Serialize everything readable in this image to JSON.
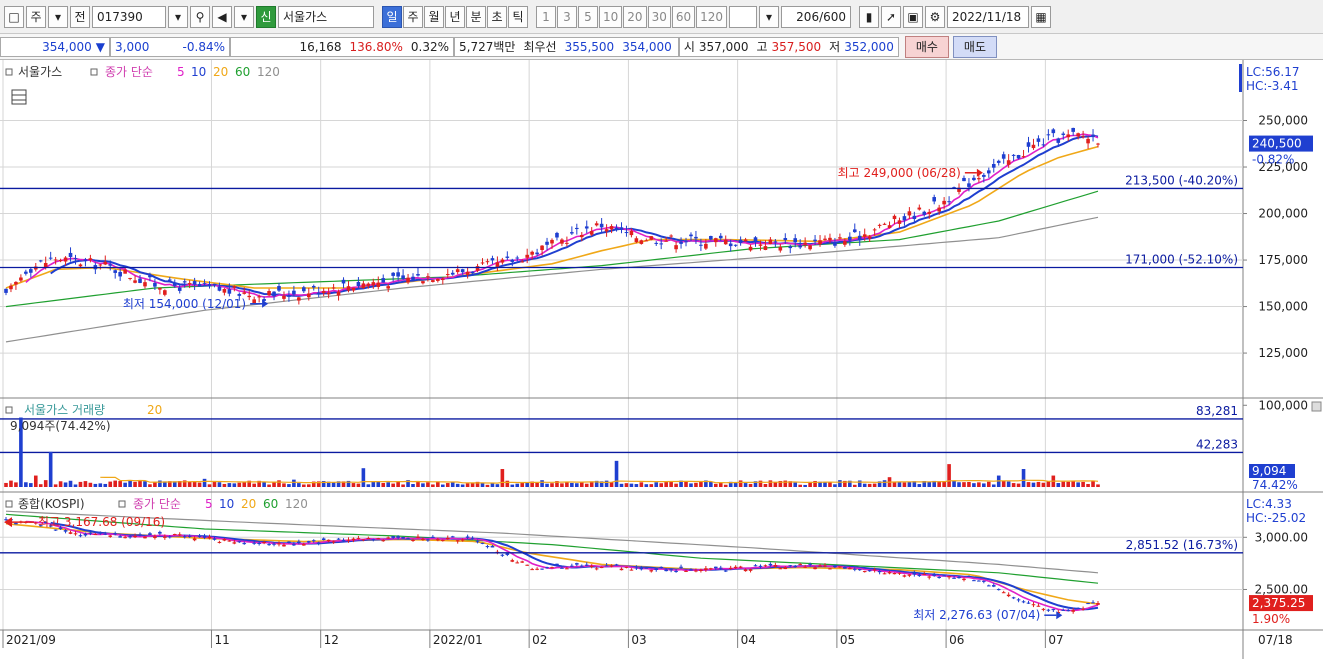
{
  "toolbar": {
    "type_label": "주",
    "prev_label": "전",
    "code": "017390",
    "new_badge": "신",
    "stock_name": "서울가스",
    "periods": [
      "일",
      "주",
      "월",
      "년",
      "분",
      "초",
      "틱"
    ],
    "active_period": "일",
    "intervals": [
      "1",
      "3",
      "5",
      "10",
      "20",
      "30",
      "60",
      "120"
    ],
    "count": "206/600",
    "date": "2022/11/18"
  },
  "quote": {
    "price": "354,000",
    "change": "3,000",
    "change_pct": "-0.84%",
    "volume": "16,168",
    "vol_ratio": "136.80%",
    "turnover_pct": "0.32%",
    "amount": "5,727백만",
    "best_label": "최우선",
    "ask": "355,500",
    "bid": "354,000",
    "open_label": "시",
    "open": "357,000",
    "high_label": "고",
    "high": "357,500",
    "low_label": "저",
    "low": "352,000",
    "buy_label": "매수",
    "sell_label": "매도"
  },
  "colors": {
    "up": "#e0201e",
    "down": "#1f3fd0",
    "ma5": "#e020c8",
    "ma10": "#1f3fd0",
    "ma20": "#f0a818",
    "ma60": "#20a030",
    "ma120": "#909090",
    "hline": "#0a1aa0",
    "grid": "#d6d6d6"
  },
  "chart_data": [
    {
      "type": "candlestick",
      "title": "서울가스",
      "legend": [
        "종가 단순",
        "5",
        "10",
        "20",
        "60",
        "120"
      ],
      "x_labels": [
        "2021/09",
        "11",
        "12",
        "2022/01",
        "02",
        "03",
        "04",
        "05",
        "06",
        "07"
      ],
      "right_axis_date": "07/18",
      "y_ticks": [
        250000,
        225000,
        200000,
        175000,
        150000,
        125000
      ],
      "y_tick_labels": [
        "250,000",
        "225,000",
        "200,000",
        "175,000",
        "150,000",
        "125,000"
      ],
      "ylim": [
        103000,
        275000
      ],
      "corner_info": [
        "LC:56.17",
        "HC:-3.41"
      ],
      "last_price_label": "240,500",
      "last_change_label": "-0.82%",
      "annotations": {
        "high": "최고 249,000 (06/28)",
        "low": "최저 154,000 (12/01)",
        "hline1": "213,500 (-40.20%)",
        "hline2": "171,000 (-52.10%)"
      },
      "hlines": [
        213500,
        171000
      ],
      "close_keypoints": [
        [
          0,
          155000
        ],
        [
          4,
          170000
        ],
        [
          10,
          176000
        ],
        [
          20,
          172000
        ],
        [
          30,
          162000
        ],
        [
          40,
          160000
        ],
        [
          52,
          156000
        ],
        [
          60,
          158000
        ],
        [
          70,
          162000
        ],
        [
          78,
          164000
        ],
        [
          86,
          167000
        ],
        [
          92,
          169000
        ],
        [
          100,
          173000
        ],
        [
          110,
          183000
        ],
        [
          116,
          191000
        ],
        [
          120,
          194000
        ],
        [
          126,
          188000
        ],
        [
          134,
          186000
        ],
        [
          146,
          185000
        ],
        [
          160,
          184000
        ],
        [
          170,
          186000
        ],
        [
          180,
          197000
        ],
        [
          188,
          205000
        ],
        [
          196,
          221000
        ],
        [
          202,
          228000
        ],
        [
          206,
          235000
        ],
        [
          210,
          240000
        ],
        [
          216,
          242000
        ],
        [
          220,
          240500
        ]
      ],
      "ma20_keypoints": [
        [
          0,
          160000
        ],
        [
          10,
          170000
        ],
        [
          20,
          171000
        ],
        [
          35,
          165000
        ],
        [
          50,
          160000
        ],
        [
          70,
          160000
        ],
        [
          90,
          166000
        ],
        [
          110,
          173000
        ],
        [
          120,
          180000
        ],
        [
          130,
          186000
        ],
        [
          145,
          186000
        ],
        [
          165,
          185000
        ],
        [
          180,
          190000
        ],
        [
          195,
          205000
        ],
        [
          205,
          222000
        ],
        [
          212,
          230000
        ],
        [
          220,
          236000
        ]
      ],
      "ma60_keypoints": [
        [
          0,
          150000
        ],
        [
          30,
          160000
        ],
        [
          60,
          163000
        ],
        [
          90,
          166000
        ],
        [
          120,
          172000
        ],
        [
          150,
          181000
        ],
        [
          180,
          186000
        ],
        [
          200,
          196000
        ],
        [
          220,
          212000
        ]
      ],
      "ma120_keypoints": [
        [
          0,
          131000
        ],
        [
          40,
          148000
        ],
        [
          80,
          160000
        ],
        [
          120,
          170000
        ],
        [
          160,
          178000
        ],
        [
          200,
          187000
        ],
        [
          220,
          198000
        ]
      ]
    },
    {
      "type": "bar",
      "title": "서울가스 거래량",
      "legend": [
        "20"
      ],
      "note": "9,094주(74.42%)",
      "y_ticks": [
        100000
      ],
      "y_tick_labels": [
        "100,000"
      ],
      "ylim": [
        0,
        104000
      ],
      "last_value_label": "9,094",
      "last_pct_label": "74.42%",
      "hline_labels": [
        "83,281",
        "42,283"
      ],
      "hlines": [
        83281,
        42283
      ],
      "spikes": [
        [
          3,
          85000
        ],
        [
          9,
          43000
        ],
        [
          6,
          14000
        ],
        [
          123,
          32000
        ],
        [
          72,
          23000
        ],
        [
          100,
          22000
        ],
        [
          190,
          28000
        ],
        [
          200,
          14000
        ],
        [
          178,
          12000
        ],
        [
          205,
          22000
        ],
        [
          211,
          14000
        ],
        [
          40,
          10000
        ],
        [
          58,
          9000
        ]
      ]
    },
    {
      "type": "candlestick",
      "title": "종합(KOSPI)",
      "legend": [
        "종가 단순",
        "5",
        "10",
        "20",
        "60",
        "120"
      ],
      "y_ticks": [
        3000,
        2500
      ],
      "y_tick_labels": [
        "3,000.00",
        "2,500.00"
      ],
      "ylim": [
        2150,
        3300
      ],
      "corner_info": [
        "LC:4.33",
        "HC:-25.02"
      ],
      "last_price_label": "2,375.25",
      "last_change_label": "1.90%",
      "annotations": {
        "high": "최고 3,167.68 (09/16)",
        "low": "최저 2,276.63 (07/04)",
        "hline1": "2,851.52 (16.73%)"
      },
      "hlines": [
        2851.52
      ],
      "close_keypoints": [
        [
          0,
          3150
        ],
        [
          8,
          3120
        ],
        [
          14,
          3030
        ],
        [
          24,
          3010
        ],
        [
          34,
          3020
        ],
        [
          44,
          2970
        ],
        [
          54,
          2930
        ],
        [
          64,
          2960
        ],
        [
          74,
          2990
        ],
        [
          84,
          2990
        ],
        [
          94,
          2980
        ],
        [
          100,
          2850
        ],
        [
          106,
          2700
        ],
        [
          112,
          2720
        ],
        [
          120,
          2720
        ],
        [
          134,
          2690
        ],
        [
          146,
          2700
        ],
        [
          160,
          2730
        ],
        [
          170,
          2700
        ],
        [
          180,
          2650
        ],
        [
          190,
          2620
        ],
        [
          196,
          2600
        ],
        [
          202,
          2430
        ],
        [
          208,
          2340
        ],
        [
          212,
          2300
        ],
        [
          216,
          2320
        ],
        [
          220,
          2375
        ]
      ],
      "ma20_keypoints": [
        [
          0,
          3130
        ],
        [
          20,
          3040
        ],
        [
          40,
          2990
        ],
        [
          60,
          2960
        ],
        [
          80,
          2980
        ],
        [
          95,
          2960
        ],
        [
          105,
          2850
        ],
        [
          120,
          2740
        ],
        [
          140,
          2690
        ],
        [
          160,
          2710
        ],
        [
          180,
          2690
        ],
        [
          195,
          2640
        ],
        [
          205,
          2500
        ],
        [
          214,
          2400
        ],
        [
          220,
          2360
        ]
      ],
      "ma60_keypoints": [
        [
          0,
          3220
        ],
        [
          40,
          3080
        ],
        [
          80,
          3010
        ],
        [
          110,
          2930
        ],
        [
          140,
          2800
        ],
        [
          170,
          2730
        ],
        [
          200,
          2660
        ],
        [
          220,
          2560
        ]
      ],
      "ma120_keypoints": [
        [
          0,
          3250
        ],
        [
          50,
          3140
        ],
        [
          100,
          3040
        ],
        [
          150,
          2900
        ],
        [
          200,
          2740
        ],
        [
          220,
          2660
        ]
      ]
    }
  ]
}
